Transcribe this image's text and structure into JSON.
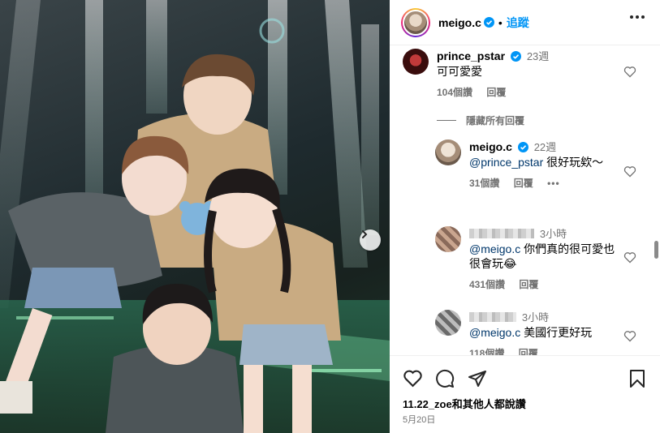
{
  "header": {
    "username": "meigo.c",
    "separator": "•",
    "follow_label": "追蹤"
  },
  "comments": {
    "main": {
      "user": "prince_pstar",
      "time": "23週",
      "text": "可可愛愛",
      "likes": "104個讚",
      "reply_label": "回覆"
    },
    "hide_replies_label": "隱藏所有回覆",
    "replies": [
      {
        "user": "meigo.c",
        "time": "22週",
        "mention": "@prince_pstar",
        "text": " 很好玩欸～",
        "likes": "31個讚",
        "reply_label": "回覆",
        "options": "•••"
      },
      {
        "time": "3小時",
        "mention": "@meigo.c",
        "text": " 你們真的很可愛也很會玩",
        "emoji": "😂",
        "likes": "431個讚",
        "reply_label": "回覆"
      },
      {
        "time": "3小時",
        "mention": "@meigo.c",
        "text": " 美國行更好玩",
        "likes": "118個讚",
        "reply_label": "回覆"
      }
    ]
  },
  "footer": {
    "liked_by_user": "11.22_zoe",
    "liked_by_rest": "和其他人都說讚",
    "date": "5月20日"
  },
  "colors": {
    "accent": "#0095f6",
    "mention": "#00376b",
    "muted": "#737373"
  }
}
